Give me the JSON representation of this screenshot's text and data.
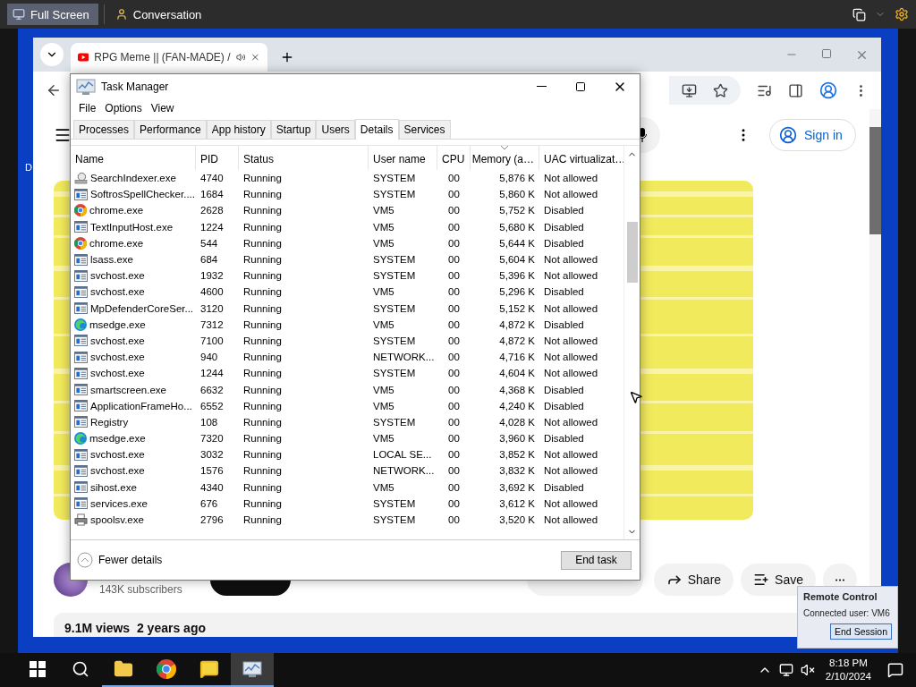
{
  "remote_bar": {
    "buttons": [
      {
        "label": "Full Screen",
        "selected": true
      },
      {
        "label": "Conversation",
        "selected": false
      }
    ]
  },
  "desktop": {
    "icon_label": "D"
  },
  "browser": {
    "tab": {
      "title": "RPG Meme || (FAN-MADE) /"
    },
    "page": {
      "sign_in": "Sign in",
      "subscribers": "143K subscribers",
      "share": "Share",
      "save": "Save",
      "views": "9.1M views  2 years ago"
    }
  },
  "task_manager": {
    "title": "Task Manager",
    "menu": [
      "File",
      "Options",
      "View"
    ],
    "tabs": [
      {
        "label": "Processes",
        "selected": false
      },
      {
        "label": "Performance",
        "selected": false
      },
      {
        "label": "App history",
        "selected": false
      },
      {
        "label": "Startup",
        "selected": false
      },
      {
        "label": "Users",
        "selected": false
      },
      {
        "label": "Details",
        "selected": true
      },
      {
        "label": "Services",
        "selected": false
      }
    ],
    "columns": [
      {
        "label": "Name",
        "sorted": false
      },
      {
        "label": "PID",
        "sorted": false
      },
      {
        "label": "Status",
        "sorted": false
      },
      {
        "label": "User name",
        "sorted": false
      },
      {
        "label": "CPU",
        "sorted": false
      },
      {
        "label": "Memory (a…",
        "sorted": true
      },
      {
        "label": "UAC virtualizat…",
        "sorted": false
      }
    ],
    "rows": [
      {
        "kind": "indexer",
        "name": "SearchIndexer.exe",
        "pid": "4740",
        "status": "Running",
        "user": "SYSTEM",
        "cpu": "00",
        "memory": "5,876 K",
        "uac": "Not allowed"
      },
      {
        "kind": "service",
        "name": "SoftrosSpellChecker....",
        "pid": "1684",
        "status": "Running",
        "user": "SYSTEM",
        "cpu": "00",
        "memory": "5,860 K",
        "uac": "Not allowed"
      },
      {
        "kind": "chrome",
        "name": "chrome.exe",
        "pid": "2628",
        "status": "Running",
        "user": "VM5",
        "cpu": "00",
        "memory": "5,752 K",
        "uac": "Disabled"
      },
      {
        "kind": "service",
        "name": "TextInputHost.exe",
        "pid": "1224",
        "status": "Running",
        "user": "VM5",
        "cpu": "00",
        "memory": "5,680 K",
        "uac": "Disabled"
      },
      {
        "kind": "chrome",
        "name": "chrome.exe",
        "pid": "544",
        "status": "Running",
        "user": "VM5",
        "cpu": "00",
        "memory": "5,644 K",
        "uac": "Disabled"
      },
      {
        "kind": "service",
        "name": "lsass.exe",
        "pid": "684",
        "status": "Running",
        "user": "SYSTEM",
        "cpu": "00",
        "memory": "5,604 K",
        "uac": "Not allowed"
      },
      {
        "kind": "service",
        "name": "svchost.exe",
        "pid": "1932",
        "status": "Running",
        "user": "SYSTEM",
        "cpu": "00",
        "memory": "5,396 K",
        "uac": "Not allowed"
      },
      {
        "kind": "service",
        "name": "svchost.exe",
        "pid": "4600",
        "status": "Running",
        "user": "VM5",
        "cpu": "00",
        "memory": "5,296 K",
        "uac": "Disabled"
      },
      {
        "kind": "service",
        "name": "MpDefenderCoreSer...",
        "pid": "3120",
        "status": "Running",
        "user": "SYSTEM",
        "cpu": "00",
        "memory": "5,152 K",
        "uac": "Not allowed"
      },
      {
        "kind": "edge",
        "name": "msedge.exe",
        "pid": "7312",
        "status": "Running",
        "user": "VM5",
        "cpu": "00",
        "memory": "4,872 K",
        "uac": "Disabled"
      },
      {
        "kind": "service",
        "name": "svchost.exe",
        "pid": "7100",
        "status": "Running",
        "user": "SYSTEM",
        "cpu": "00",
        "memory": "4,872 K",
        "uac": "Not allowed"
      },
      {
        "kind": "service",
        "name": "svchost.exe",
        "pid": "940",
        "status": "Running",
        "user": "NETWORK...",
        "cpu": "00",
        "memory": "4,716 K",
        "uac": "Not allowed"
      },
      {
        "kind": "service",
        "name": "svchost.exe",
        "pid": "1244",
        "status": "Running",
        "user": "SYSTEM",
        "cpu": "00",
        "memory": "4,604 K",
        "uac": "Not allowed"
      },
      {
        "kind": "service",
        "name": "smartscreen.exe",
        "pid": "6632",
        "status": "Running",
        "user": "VM5",
        "cpu": "00",
        "memory": "4,368 K",
        "uac": "Disabled"
      },
      {
        "kind": "service",
        "name": "ApplicationFrameHo...",
        "pid": "6552",
        "status": "Running",
        "user": "VM5",
        "cpu": "00",
        "memory": "4,240 K",
        "uac": "Disabled"
      },
      {
        "kind": "service",
        "name": "Registry",
        "pid": "108",
        "status": "Running",
        "user": "SYSTEM",
        "cpu": "00",
        "memory": "4,028 K",
        "uac": "Not allowed"
      },
      {
        "kind": "edge",
        "name": "msedge.exe",
        "pid": "7320",
        "status": "Running",
        "user": "VM5",
        "cpu": "00",
        "memory": "3,960 K",
        "uac": "Disabled"
      },
      {
        "kind": "service",
        "name": "svchost.exe",
        "pid": "3032",
        "status": "Running",
        "user": "LOCAL SE...",
        "cpu": "00",
        "memory": "3,852 K",
        "uac": "Not allowed"
      },
      {
        "kind": "service",
        "name": "svchost.exe",
        "pid": "1576",
        "status": "Running",
        "user": "NETWORK...",
        "cpu": "00",
        "memory": "3,832 K",
        "uac": "Not allowed"
      },
      {
        "kind": "service",
        "name": "sihost.exe",
        "pid": "4340",
        "status": "Running",
        "user": "VM5",
        "cpu": "00",
        "memory": "3,692 K",
        "uac": "Disabled"
      },
      {
        "kind": "service",
        "name": "services.exe",
        "pid": "676",
        "status": "Running",
        "user": "SYSTEM",
        "cpu": "00",
        "memory": "3,612 K",
        "uac": "Not allowed"
      },
      {
        "kind": "printer",
        "name": "spoolsv.exe",
        "pid": "2796",
        "status": "Running",
        "user": "SYSTEM",
        "cpu": "00",
        "memory": "3,520 K",
        "uac": "Not allowed"
      }
    ],
    "fewer_details": "Fewer details",
    "end_task": "End task"
  },
  "taskbar": {
    "apps": [
      {
        "kind": "explorer",
        "active": false
      },
      {
        "kind": "chrome",
        "active": false
      },
      {
        "kind": "chat",
        "active": false
      },
      {
        "kind": "taskmanager",
        "active": true
      }
    ],
    "time": "8:18 PM",
    "date": "2/10/2024"
  },
  "remote_popup": {
    "title": "Remote Control",
    "connected": "Connected user: VM6",
    "button": "End Session"
  }
}
